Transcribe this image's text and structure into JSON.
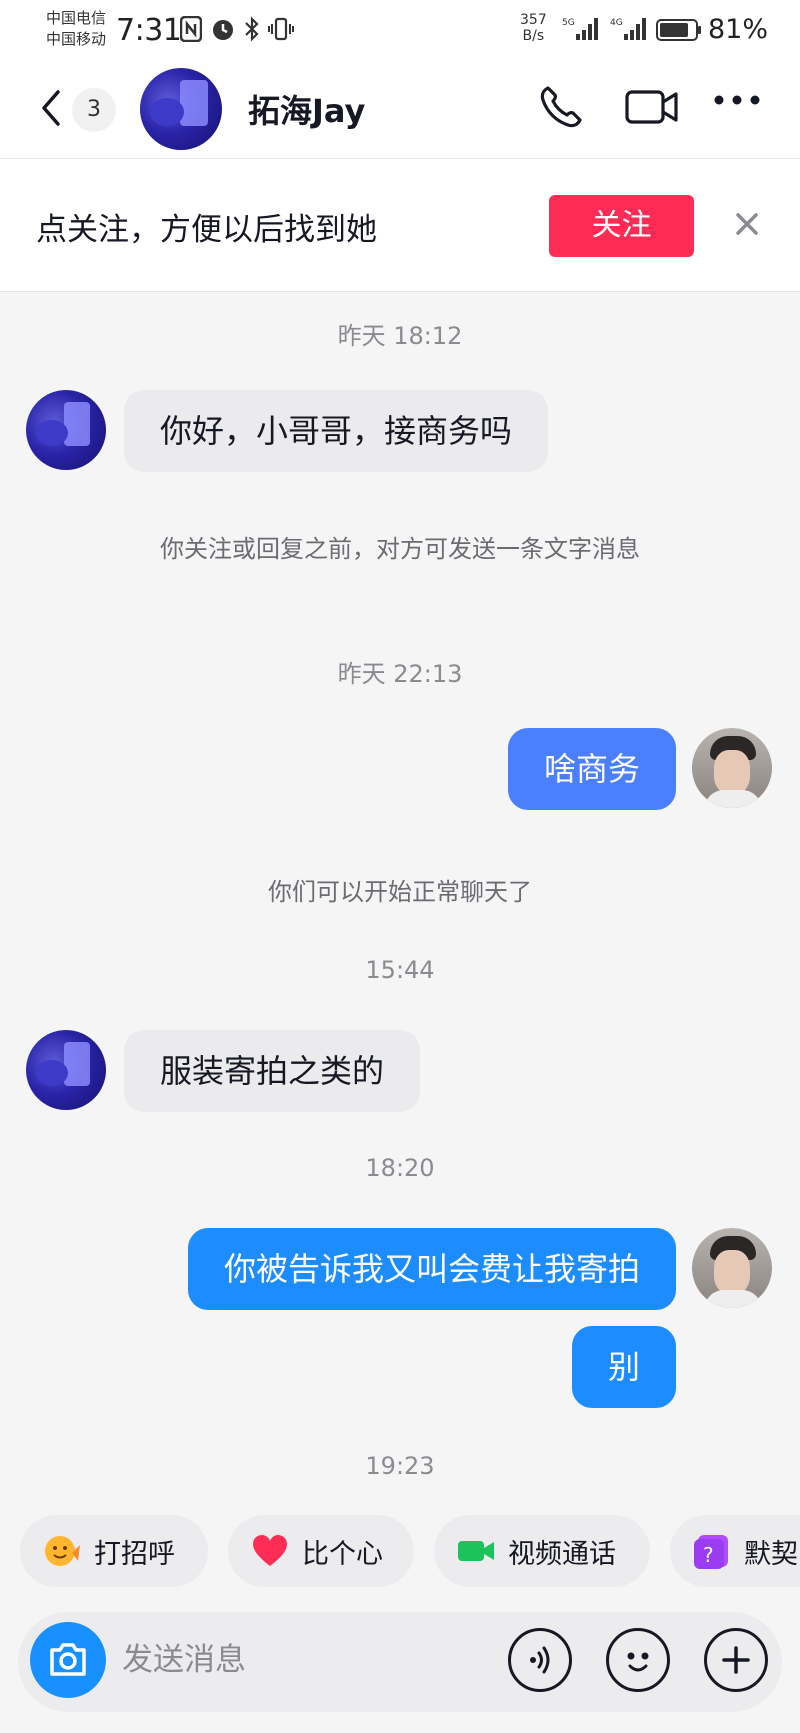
{
  "status_bar": {
    "carrier_1": "中国电信",
    "carrier_2": "中国移动",
    "time": "7:31",
    "net_speed_value": "357",
    "net_speed_unit": "B/s",
    "sig1_label": "5G",
    "sig2_label": "4G",
    "battery_level": 0.81,
    "battery_text": "81%"
  },
  "header": {
    "unread_count": "3",
    "peer_name": "拓海Jay",
    "icons": [
      "back-icon",
      "phone-icon",
      "video-call-icon",
      "more-icon"
    ]
  },
  "follow_banner": {
    "text": "点关注，方便以后找到她",
    "button_label": "关注",
    "button_color": "#fe2c55"
  },
  "messages": {
    "ts_1": "昨天 18:12",
    "in_1": "你好，小哥哥，接商务吗",
    "sys_1": "你关注或回复之前，对方可发送一条文字消息",
    "ts_2": "昨天 22:13",
    "out_1": "啥商务",
    "sys_2": "你们可以开始正常聊天了",
    "ts_3": "15:44",
    "in_2": "服装寄拍之类的",
    "ts_4": "18:20",
    "out_2": "你被告诉我又叫会费让我寄拍",
    "out_3": "别",
    "ts_5": "19:23"
  },
  "quick_actions": [
    {
      "label": "打招呼",
      "icon": "waving-hand-icon"
    },
    {
      "label": "比个心",
      "icon": "heart-icon"
    },
    {
      "label": "视频通话",
      "icon": "video-icon"
    },
    {
      "label": "默契",
      "icon": "quiz-icon"
    }
  ],
  "composer": {
    "placeholder": "发送消息",
    "icons": [
      "camera-icon",
      "voice-icon",
      "emoji-icon",
      "plus-icon"
    ]
  },
  "colors": {
    "outgoing_bubble": "#4a7fff",
    "incoming_bubble": "#ebebed",
    "accent_blue": "#1890ff"
  }
}
